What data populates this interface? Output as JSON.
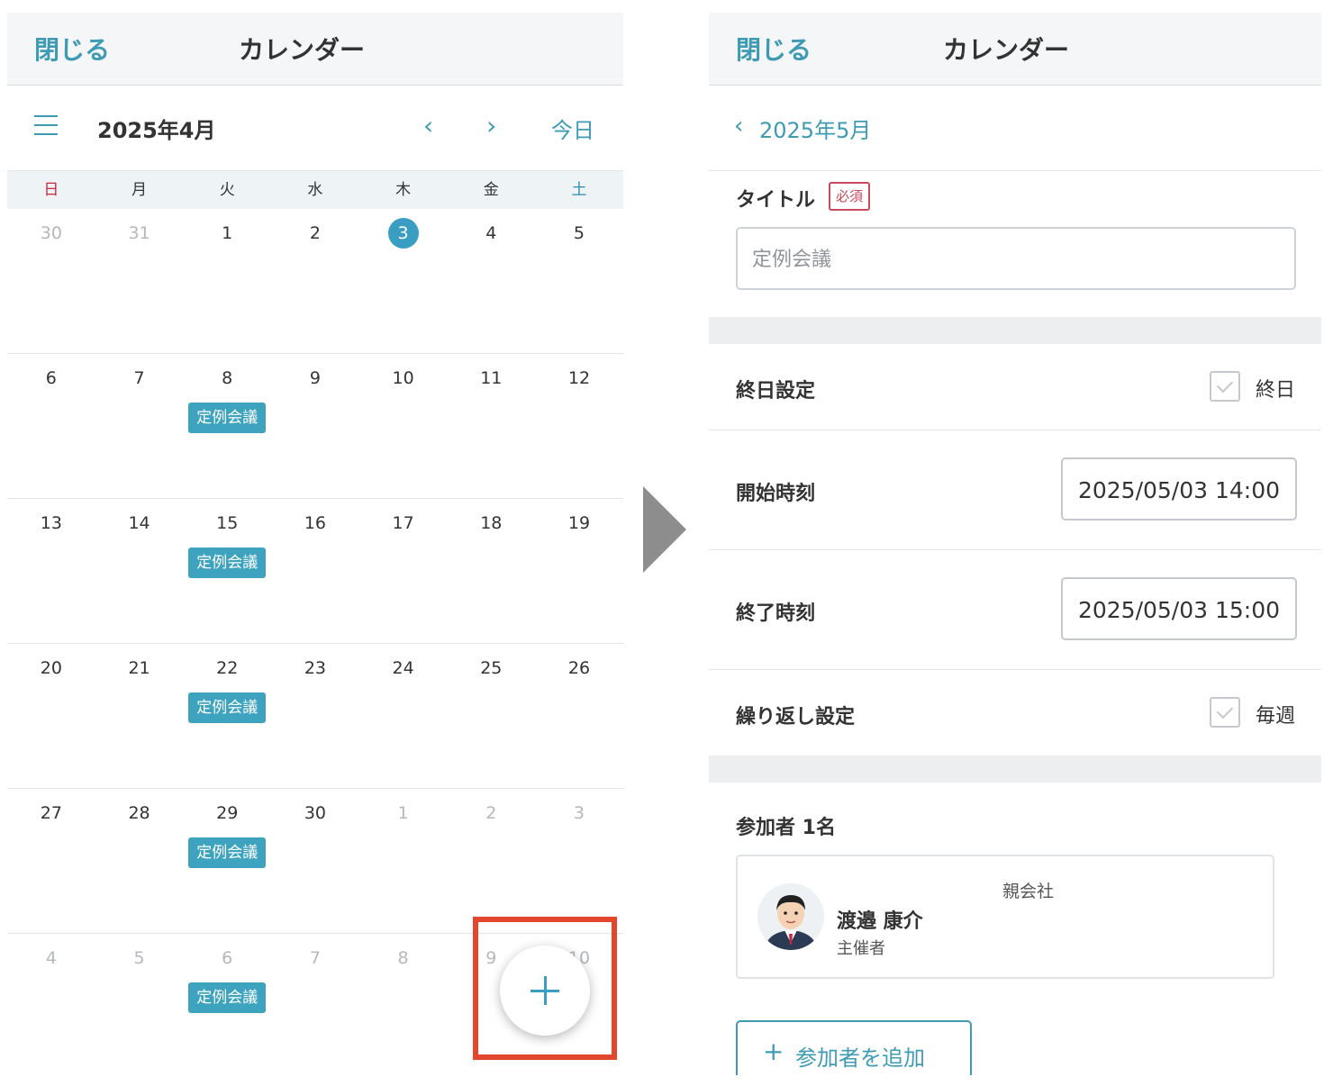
{
  "left": {
    "header": {
      "close_label": "閉じる",
      "title": "カレンダー"
    },
    "toolbar": {
      "month": "2025年4月",
      "prev": "‹",
      "next": "›",
      "today": "今日"
    },
    "weekdays": [
      "日",
      "月",
      "火",
      "水",
      "木",
      "金",
      "土"
    ],
    "weeks": [
      [
        {
          "d": "30",
          "muted": true
        },
        {
          "d": "31",
          "muted": true
        },
        {
          "d": "1"
        },
        {
          "d": "2"
        },
        {
          "d": "3",
          "today": true
        },
        {
          "d": "4"
        },
        {
          "d": "5"
        }
      ],
      [
        {
          "d": "6"
        },
        {
          "d": "7"
        },
        {
          "d": "8",
          "event": "定例会議"
        },
        {
          "d": "9"
        },
        {
          "d": "10"
        },
        {
          "d": "11"
        },
        {
          "d": "12"
        }
      ],
      [
        {
          "d": "13"
        },
        {
          "d": "14"
        },
        {
          "d": "15",
          "event": "定例会議"
        },
        {
          "d": "16"
        },
        {
          "d": "17"
        },
        {
          "d": "18"
        },
        {
          "d": "19"
        }
      ],
      [
        {
          "d": "20"
        },
        {
          "d": "21"
        },
        {
          "d": "22",
          "event": "定例会議"
        },
        {
          "d": "23"
        },
        {
          "d": "24"
        },
        {
          "d": "25"
        },
        {
          "d": "26"
        }
      ],
      [
        {
          "d": "27"
        },
        {
          "d": "28"
        },
        {
          "d": "29",
          "event": "定例会議"
        },
        {
          "d": "30"
        },
        {
          "d": "1",
          "muted": true
        },
        {
          "d": "2",
          "muted": true
        },
        {
          "d": "3",
          "muted": true
        }
      ],
      [
        {
          "d": "4",
          "muted": true
        },
        {
          "d": "5",
          "muted": true
        },
        {
          "d": "6",
          "muted": true,
          "event": "定例会議"
        },
        {
          "d": "7",
          "muted": true
        },
        {
          "d": "8",
          "muted": true
        },
        {
          "d": "9",
          "muted": true
        },
        {
          "d": "10",
          "muted": true
        }
      ]
    ]
  },
  "right": {
    "header": {
      "close_label": "閉じる",
      "title": "カレンダー"
    },
    "back": {
      "chevron": "‹",
      "label": "2025年5月"
    },
    "title_field": {
      "label": "タイトル",
      "required": "必須",
      "value": "定例会議"
    },
    "all_day": {
      "label": "終日設定",
      "check_label": "終日"
    },
    "start": {
      "label": "開始時刻",
      "value": "2025/05/03 14:00"
    },
    "end": {
      "label": "終了時刻",
      "value": "2025/05/03 15:00"
    },
    "repeat": {
      "label": "繰り返し設定",
      "check_label": "毎週"
    },
    "participants": {
      "heading": "参加者 1名",
      "items": [
        {
          "company": "親会社",
          "name": "渡邉 康介",
          "role": "主催者"
        }
      ],
      "add_plus": "+",
      "add_label": "参加者を追加"
    }
  },
  "colors": {
    "accent": "#3f9bb4",
    "today": "#3a9ec3",
    "event": "#3ea3be",
    "highlight_frame": "#e2462c",
    "sunday": "#c8283c",
    "saturday": "#2f8cb0"
  }
}
